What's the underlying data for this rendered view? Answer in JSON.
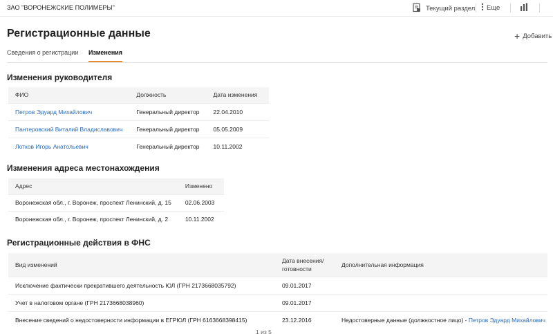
{
  "topbar": {
    "company_name": "ЗАО \"ВОРОНЕЖСКИЕ ПОЛИМЕРЫ\"",
    "current_section_label": "Текущий раздел",
    "more_label": "Еще"
  },
  "page": {
    "title": "Регистрационные данные",
    "add_label": "Добавить"
  },
  "tabs": [
    {
      "label": "Сведения о регистрации"
    },
    {
      "label": "Изменения"
    }
  ],
  "managers": {
    "title": "Изменения руководителя",
    "columns": [
      "ФИО",
      "Должность",
      "Дата изменения"
    ],
    "rows": [
      {
        "name": "Петров Эдуард Михайлович",
        "position": "Генеральный директор",
        "date": "22.04.2010"
      },
      {
        "name": "Пантеровский Виталий Владиславович",
        "position": "Генеральный директор",
        "date": "05.05.2009"
      },
      {
        "name": "Лотков Игорь Анатольевич",
        "position": "Генеральный директор",
        "date": "10.11.2002"
      }
    ]
  },
  "addresses": {
    "title": "Изменения адреса местонахождения",
    "columns": [
      "Адрес",
      "Изменено"
    ],
    "rows": [
      {
        "address": "Воронежская обл., г. Воронеж, проспект Ленинский, д. 15",
        "date": "02.06.2003"
      },
      {
        "address": "Воронежская обл., г. Воронеж, проспект Ленинский, д. 2",
        "date": "10.11.2002"
      }
    ]
  },
  "fns": {
    "title": "Регистрационные действия в ФНС",
    "columns": [
      "Вид изменений",
      "Дата внесения/ готовности",
      "Дополнительная информация"
    ],
    "rows": [
      {
        "kind": "Исключение фактически прекратившего деятельность ЮЛ (ГРН 2173668035792)",
        "date": "09.01.2017",
        "info": "",
        "info_link": ""
      },
      {
        "kind": "Учет в налоговом органе (ГРН 2173668038960)",
        "date": "09.01.2017",
        "info": "",
        "info_link": ""
      },
      {
        "kind": "Внесение сведений о недостоверности информации в ЕГРЮЛ (ГРН 6163668398415)",
        "date": "23.12.2016",
        "info": "Недостоверные данные (должностное лицо) - ",
        "info_link": "Петров Эдуард Михайлович"
      }
    ]
  },
  "pager": {
    "text": "1 из 5"
  }
}
